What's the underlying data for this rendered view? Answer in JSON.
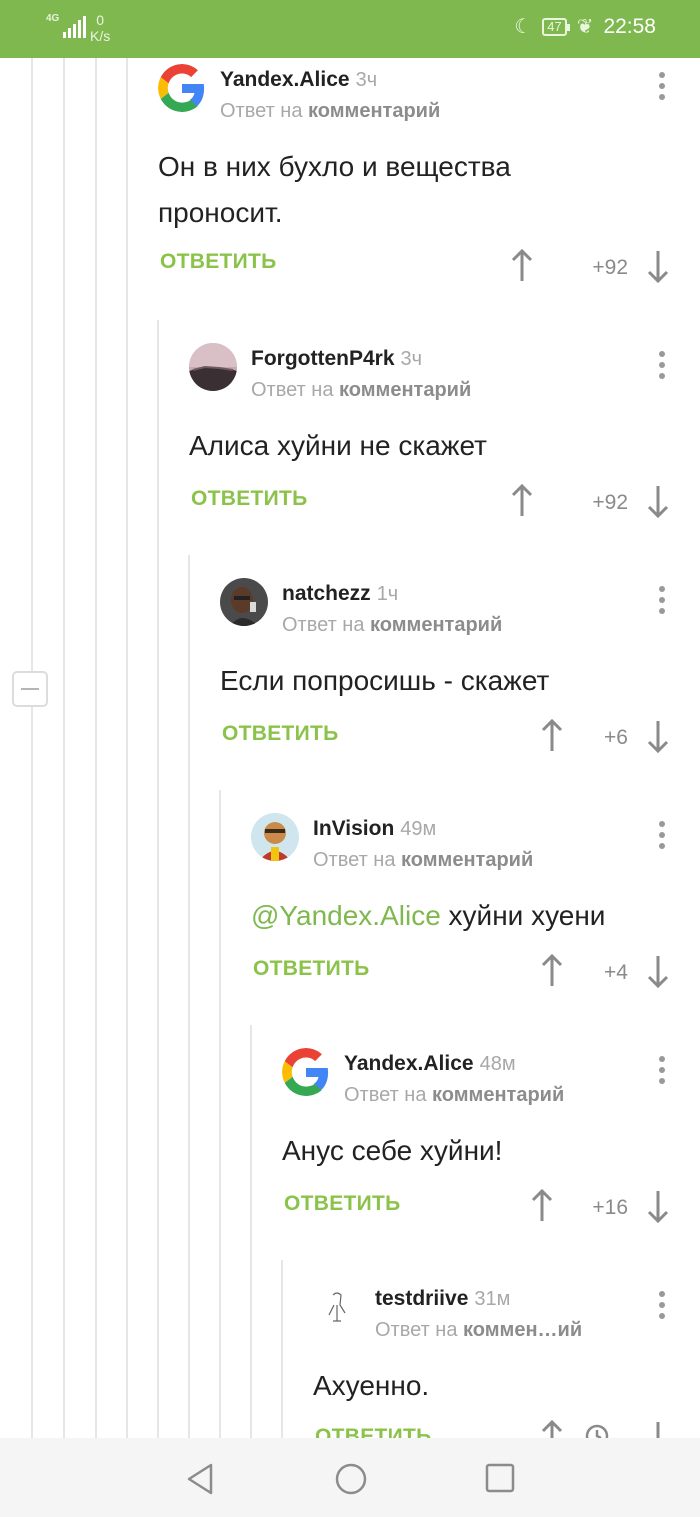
{
  "status_bar": {
    "network": "4G",
    "speed_value": "0",
    "speed_unit": "K/s",
    "battery": "47",
    "time": "22:58"
  },
  "comments": [
    {
      "author": "Yandex.Alice",
      "time": "3ч",
      "reply_prefix": "Ответ на",
      "reply_target": "комментарий",
      "text": "Он в них бухло и вещества проносит.",
      "reply_label": "ОТВЕТИТЬ",
      "score": "+92",
      "avatar": "google-g-icon"
    },
    {
      "author": "ForgottenP4rk",
      "time": "3ч",
      "reply_prefix": "Ответ на",
      "reply_target": "комментарий",
      "text": "Алиса хуйни не скажет",
      "reply_label": "ОТВЕТИТЬ",
      "score": "+92",
      "avatar": "landscape-avatar"
    },
    {
      "author": "natchezz",
      "time": "1ч",
      "reply_prefix": "Ответ на",
      "reply_target": "комментарий",
      "text": "Если попросишь - скажет",
      "reply_label": "ОТВЕТИТЬ",
      "score": "+6",
      "avatar": "person-avatar"
    },
    {
      "author": "InVision",
      "time": "49м",
      "reply_prefix": "Ответ на",
      "reply_target": "комментарий",
      "mention": "@Yandex.Alice",
      "text": " хуйни хуени",
      "reply_label": "ОТВЕТИТЬ",
      "score": "+4",
      "avatar": "cartoon-avatar"
    },
    {
      "author": "Yandex.Alice",
      "time": "48м",
      "reply_prefix": "Ответ на",
      "reply_target": "комментарий",
      "text": "Анус себе хуйни!",
      "reply_label": "ОТВЕТИТЬ",
      "score": "+16",
      "avatar": "google-g-icon"
    },
    {
      "author": "testdriive",
      "time": "31м",
      "reply_prefix": "Ответ на",
      "reply_target": "коммен…ий",
      "text": "Ахуенно.",
      "reply_label": "ОТВЕТИТЬ",
      "score": "",
      "avatar": "sketch-avatar"
    }
  ],
  "colors": {
    "accent": "#7fb84f",
    "reply": "#8bc34a",
    "meta": "#a8a8a8"
  }
}
